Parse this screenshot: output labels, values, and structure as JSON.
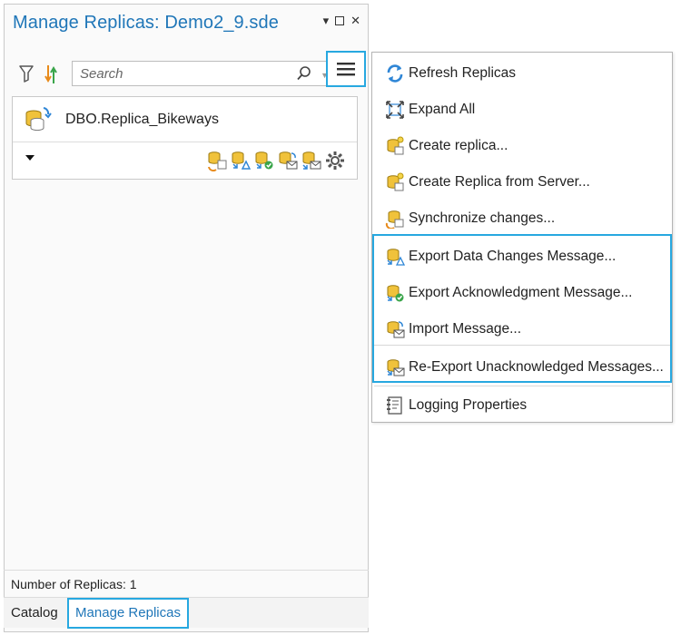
{
  "pane": {
    "title": "Manage Replicas: Demo2_9.sde",
    "controls": {
      "dropdown": "▾",
      "close": "✕"
    }
  },
  "toolbar": {
    "search_placeholder": "Search"
  },
  "replica": {
    "name": "DBO.Replica_Bikeways"
  },
  "status": {
    "text": "Number of Replicas: 1"
  },
  "tabs": {
    "catalog": "Catalog",
    "manage": "Manage Replicas"
  },
  "menu": {
    "items": [
      {
        "label": "Refresh Replicas",
        "icon": "refresh-icon"
      },
      {
        "label": "Expand All",
        "icon": "expand-all-icon"
      },
      {
        "label": "Create replica...",
        "icon": "create-replica-icon"
      },
      {
        "label": "Create Replica from Server...",
        "icon": "create-replica-server-icon"
      },
      {
        "label": "Synchronize changes...",
        "icon": "synchronize-icon"
      },
      {
        "label": "Export Data Changes Message...",
        "icon": "export-data-changes-icon"
      },
      {
        "label": "Export Acknowledgment Message...",
        "icon": "export-acknowledgment-icon"
      },
      {
        "label": "Import Message...",
        "icon": "import-message-icon"
      },
      {
        "label": "Re-Export Unacknowledged Messages...",
        "icon": "re-export-icon"
      },
      {
        "label": "Logging Properties",
        "icon": "logging-properties-icon"
      }
    ]
  },
  "colors": {
    "accent": "#27a8e0",
    "title": "#1f76b8",
    "db_yellow": "#f0c23b",
    "refresh_blue": "#2f86d6",
    "sync_orange": "#e88a1a",
    "ok_green": "#3aa54a"
  }
}
